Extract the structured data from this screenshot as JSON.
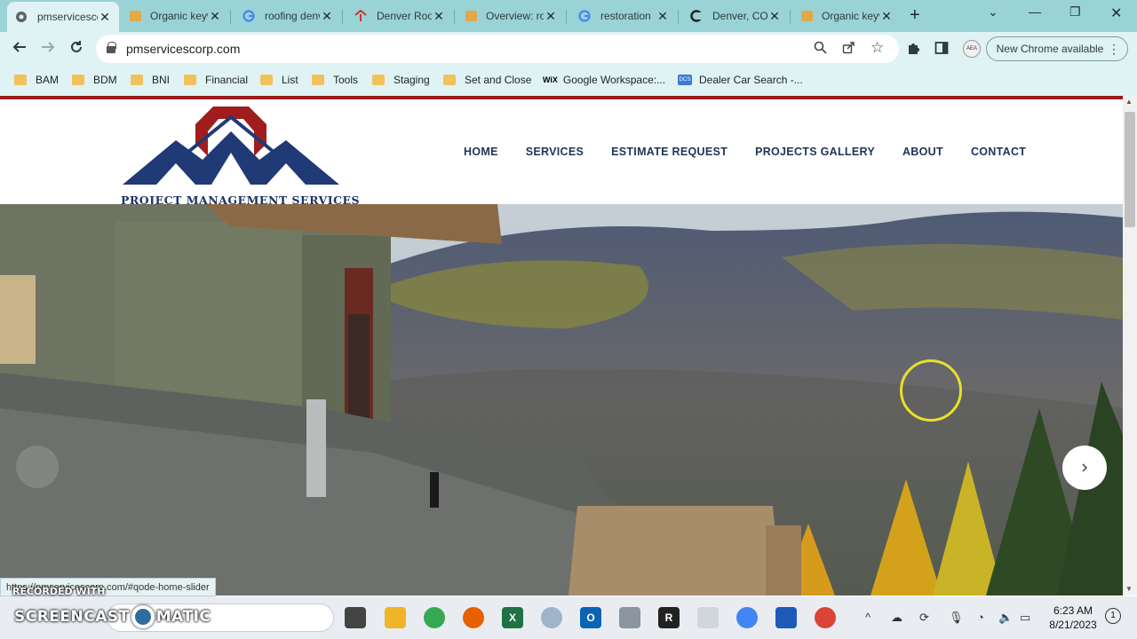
{
  "browser": {
    "tabs": [
      {
        "title": "pmservicescorp.com",
        "favicon": "globe-icon",
        "active": true
      },
      {
        "title": "Organic keywords",
        "favicon": "folder-icon"
      },
      {
        "title": "roofing denver",
        "favicon": "google-icon"
      },
      {
        "title": "Denver Roofing",
        "favicon": "roofing-logo-icon"
      },
      {
        "title": "Overview: roofing",
        "favicon": "folder-icon"
      },
      {
        "title": "restoration",
        "favicon": "google-icon"
      },
      {
        "title": "Denver, CO",
        "favicon": "dial-icon"
      },
      {
        "title": "Organic keywords",
        "favicon": "folder-icon"
      }
    ],
    "url": "pmservicescorp.com",
    "new_chrome_label": "New Chrome available",
    "profile_text": "AEA",
    "bookmarks": [
      {
        "label": "BAM",
        "icon": "folder-icon"
      },
      {
        "label": "BDM",
        "icon": "folder-icon"
      },
      {
        "label": "BNI",
        "icon": "folder-icon"
      },
      {
        "label": "Financial",
        "icon": "folder-icon"
      },
      {
        "label": "List",
        "icon": "folder-icon"
      },
      {
        "label": "Tools",
        "icon": "folder-icon"
      },
      {
        "label": "Staging",
        "icon": "folder-icon"
      },
      {
        "label": "Set and Close",
        "icon": "folder-icon"
      },
      {
        "label": "Google Workspace:...",
        "icon": "wix-icon",
        "badge": "WiX"
      },
      {
        "label": "Dealer Car Search -...",
        "icon": "dcs-icon",
        "badge": "DCS"
      }
    ],
    "status_url": "https://pmservicescorp.com/#qode-home-slider"
  },
  "site": {
    "logo_text": "PROJECT MANAGEMENT SERVICES",
    "nav": [
      "HOME",
      "SERVICES",
      "ESTIMATE REQUEST",
      "PROJECTS GALLERY",
      "ABOUT",
      "CONTACT"
    ],
    "accent_color": "#9b1b1b",
    "nav_color": "#1e3458"
  },
  "taskbar": {
    "time": "6:23 AM",
    "date": "8/21/2023",
    "notifications": "1"
  },
  "watermark": {
    "line1": "RECORDED WITH",
    "line2a": "SCREENCAST",
    "line2b": "MATIC"
  }
}
